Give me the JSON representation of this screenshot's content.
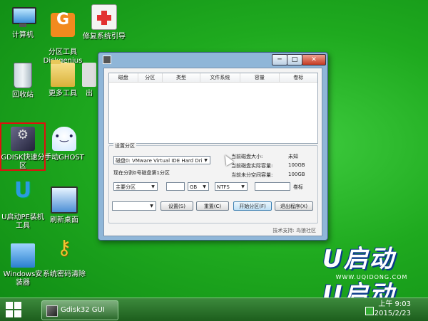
{
  "desktop": {
    "icons": [
      {
        "label": "计算机",
        "icon": "computer-icon"
      },
      {
        "label": "分区工具\nDiskgenius",
        "icon": "diskgenius-icon"
      },
      {
        "label": "修复系统引导",
        "icon": "repair-boot-icon"
      },
      {
        "label": "回收站",
        "icon": "recycle-bin-icon"
      },
      {
        "label": "更多工具",
        "icon": "folder-icon"
      },
      {
        "label": "GDISK快速分区",
        "icon": "gdisk-icon"
      },
      {
        "label": "手动GHOST",
        "icon": "ghost-icon"
      },
      {
        "label": "U启动PE装机工具",
        "icon": "pe-installer-icon"
      },
      {
        "label": "刷新桌面",
        "icon": "refresh-desktop-icon"
      },
      {
        "label": "Windows安装器",
        "icon": "windows-installer-icon"
      },
      {
        "label": "系统密码清除",
        "icon": "key-icon"
      }
    ],
    "partial_label": "出"
  },
  "watermark": {
    "brand": "U启动",
    "url": "WWW.UQIDONG.COM"
  },
  "window": {
    "title": "",
    "list_columns": [
      "磁盘",
      "分区",
      "类型",
      "文件系统",
      "容量",
      "卷标"
    ],
    "group_label": "设置分区",
    "disk_select": "磁盘0: VMware Virtual IDE Hard Dri",
    "status_text": "现在分割0号磁盘第1分区",
    "info": [
      {
        "label": "当前磁盘大小:",
        "value": "未知"
      },
      {
        "label": "当前磁盘实际容量:",
        "value": "100GB"
      },
      {
        "label": "当前未分空间容量:",
        "value": "100GB"
      }
    ],
    "partition_type": "主要分区",
    "size_value": "",
    "size_unit": "GB",
    "filesystem": "NTFS",
    "volume_label_value": "",
    "volume_label_text": "卷标",
    "bottom_select": "",
    "buttons": {
      "settings": "设置(S)",
      "reset": "重置(C)",
      "start": "开始分区(F)",
      "exit": "退出程序(X)"
    },
    "footer": "技术支持: 鸟狼社区"
  },
  "taskbar": {
    "task_label": "Gdisk32 GUI",
    "time": "上午 9:03",
    "date": "2015/2/23"
  },
  "colors": {
    "desktop_green": "#1faa1f",
    "selection_red": "#e01010",
    "window_frame": "#8fb6d8"
  }
}
